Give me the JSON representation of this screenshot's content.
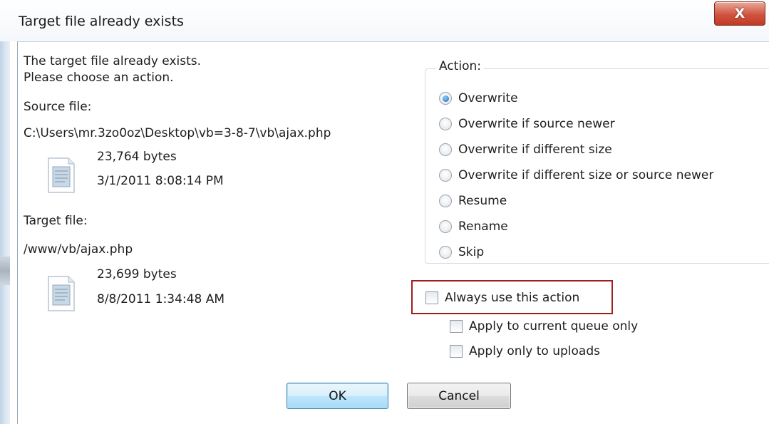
{
  "window": {
    "title": "Target file already exists",
    "close_glyph": "X"
  },
  "message": {
    "line1": "The target file already exists.",
    "line2": "Please choose an action."
  },
  "source": {
    "label": "Source file:",
    "path": "C:\\Users\\mr.3zo0oz\\Desktop\\vb=3-8-7\\vb\\ajax.php",
    "size": "23,764 bytes",
    "date": "3/1/2011 8:08:14 PM",
    "icon": "document-icon"
  },
  "target": {
    "label": "Target file:",
    "path": "/www/vb/ajax.php",
    "size": "23,699 bytes",
    "date": "8/8/2011 1:34:48 AM",
    "icon": "document-icon"
  },
  "action": {
    "group_label": "Action:",
    "selected": "Overwrite",
    "options": [
      "Overwrite",
      "Overwrite if source newer",
      "Overwrite if different size",
      "Overwrite if different size or source newer",
      "Resume",
      "Rename",
      "Skip"
    ]
  },
  "checkboxes": {
    "always": {
      "label": "Always use this action",
      "checked": false
    },
    "current_queue": {
      "label": "Apply to current queue only",
      "checked": false
    },
    "uploads": {
      "label": "Apply only to uploads",
      "checked": false
    }
  },
  "buttons": {
    "ok": "OK",
    "cancel": "Cancel"
  },
  "colors": {
    "highlight_border": "#9b1f1f",
    "radio_selected": "#1a63b5",
    "close_button": "#c03a26"
  }
}
